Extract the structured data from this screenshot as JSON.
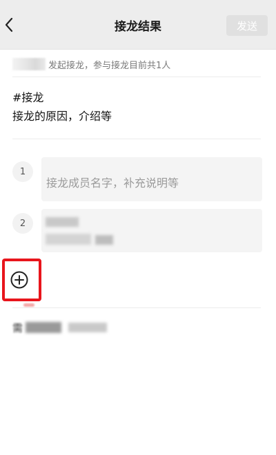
{
  "header": {
    "title": "接龙结果",
    "send_label": "发送"
  },
  "initiator": {
    "text": "发起接龙，参与接龙目前共1人"
  },
  "topic": {
    "tag": "#接龙",
    "description": "接龙的原因，介绍等"
  },
  "entries": [
    {
      "number": "1",
      "text": "接龙成员名字，补充说明等"
    },
    {
      "number": "2",
      "text": ""
    }
  ],
  "footer": {
    "text": "需"
  },
  "colors": {
    "header_bg": "#ededed",
    "send_button_bg": "#e0e0e0",
    "highlight": "#e8151c"
  },
  "icons": {
    "back": "chevron-left-icon",
    "add": "plus-circle-icon"
  }
}
